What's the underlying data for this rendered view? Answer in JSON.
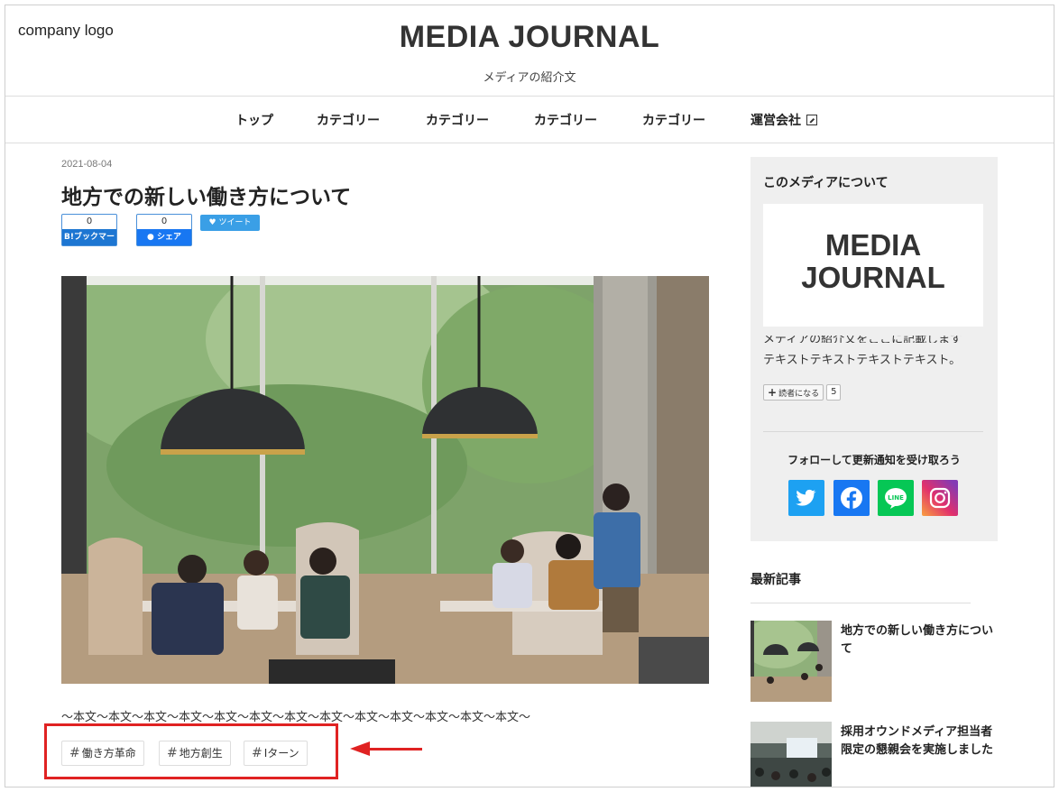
{
  "header": {
    "company_logo": "company logo",
    "site_title": "MEDIA JOURNAL",
    "site_description": "メディアの紹介文"
  },
  "nav": {
    "items": [
      {
        "label": "トップ"
      },
      {
        "label": "カテゴリー"
      },
      {
        "label": "カテゴリー"
      },
      {
        "label": "カテゴリー"
      },
      {
        "label": "カテゴリー"
      },
      {
        "label": "運営会社",
        "icon": "external-link-icon"
      }
    ]
  },
  "article": {
    "date": "2021-08-04",
    "title": "地方での新しい働き方について",
    "bookmark": {
      "count": "0",
      "label": "B!ブックマーク"
    },
    "facebook": {
      "count": "0",
      "label": "シェア"
    },
    "tweet_label": "ツイート",
    "body": "〜本文〜本文〜本文〜本文〜本文〜本文〜本文〜本文〜本文〜本文〜本文〜本文〜本文〜",
    "tags": [
      {
        "hash": "#",
        "label": "働き方革命"
      },
      {
        "hash": "#",
        "label": "地方創生"
      },
      {
        "hash": "#",
        "label": "Iターン"
      }
    ]
  },
  "sidebar": {
    "about": {
      "heading": "このメディアについて",
      "logo_line1": "MEDIA",
      "logo_line2": "JOURNAL",
      "text_clipped": "メディアの紹介文をここに記載します",
      "text": "テキストテキストテキストテキスト。",
      "subscribe_label": "読者になる",
      "subscribe_plus": "+",
      "subscriber_count": "5",
      "follow_heading": "フォローして更新通知を受け取ろう"
    },
    "latest": {
      "heading": "最新記事",
      "items": [
        {
          "title": "地方での新しい働き方について"
        },
        {
          "title": "採用オウンドメディア担当者限定の懇親会を実施しました"
        }
      ]
    }
  },
  "colors": {
    "highlight": "#e02222",
    "twitter": "#1da1f2",
    "facebook": "#1877f2",
    "line": "#06c755"
  }
}
